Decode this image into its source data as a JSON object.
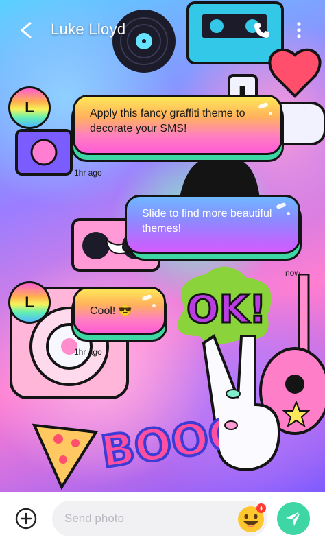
{
  "header": {
    "contact_name": "Luke Lloyd"
  },
  "messages": [
    {
      "avatar_letter": "L",
      "text": "Apply this fancy graffiti theme to decorate your SMS!",
      "time": "1hr ago",
      "direction": "incoming"
    },
    {
      "text": "Slide to find more beautiful themes!",
      "time": "now",
      "direction": "outgoing"
    },
    {
      "avatar_letter": "L",
      "text": "Cool! 😎",
      "time": "1hr ago",
      "direction": "incoming"
    }
  ],
  "composer": {
    "placeholder": "Send photo"
  },
  "background_art": {
    "ok_text": "OK!",
    "love_text": "I",
    "boo_text": "BOOO"
  },
  "colors": {
    "accent": "#3fd6a6",
    "bubble_incoming_top": "#ffe85a",
    "bubble_incoming_bottom": "#ff5bd6",
    "bubble_outgoing_top": "#6fb8ff",
    "bubble_outgoing_bottom": "#d45cff"
  },
  "icons": [
    "back-arrow-icon",
    "phone-icon",
    "more-vertical-icon",
    "add-circle-icon",
    "emoji-icon",
    "send-icon"
  ]
}
